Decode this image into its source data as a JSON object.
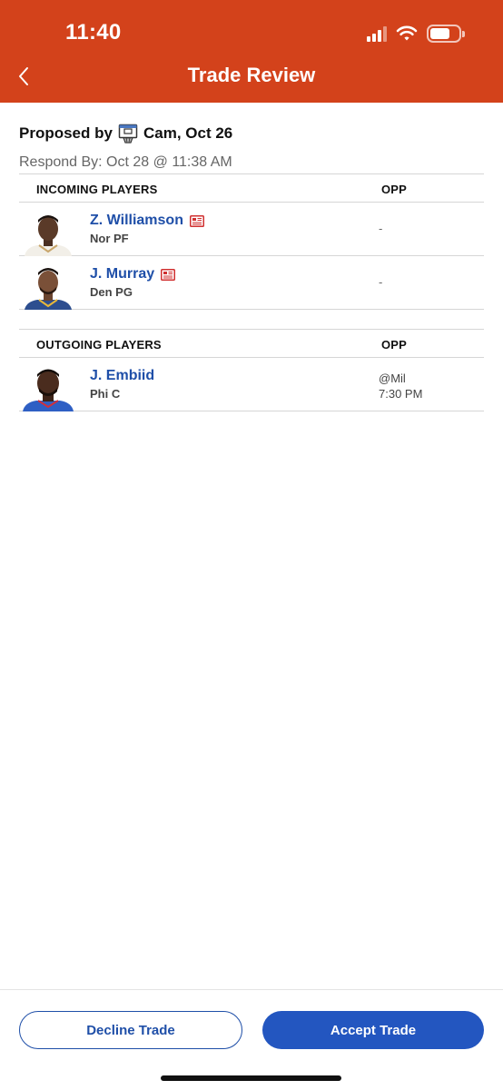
{
  "status_bar": {
    "time": "11:40"
  },
  "header": {
    "title": "Trade Review"
  },
  "proposal": {
    "proposed_by_label": "Proposed by",
    "proposer": "Cam, Oct 26",
    "respond_by": "Respond By: Oct 28 @ 11:38 AM"
  },
  "incoming": {
    "header": "INCOMING PLAYERS",
    "opp_header": "OPP",
    "players": [
      {
        "name": "Z. Williamson",
        "team_pos": "Nor PF",
        "opp": "-"
      },
      {
        "name": "J. Murray",
        "team_pos": "Den PG",
        "opp": "-"
      }
    ]
  },
  "outgoing": {
    "header": "OUTGOING PLAYERS",
    "opp_header": "OPP",
    "players": [
      {
        "name": "J. Embiid",
        "team_pos": "Phi C",
        "opp": "@Mil",
        "opp_time": "7:30 PM"
      }
    ]
  },
  "footer": {
    "decline_label": "Decline Trade",
    "accept_label": "Accept Trade"
  },
  "colors": {
    "header_bg": "#d3421b",
    "link_blue": "#1f4fa8",
    "accept_bg": "#2356c0",
    "news_red": "#d03030"
  }
}
